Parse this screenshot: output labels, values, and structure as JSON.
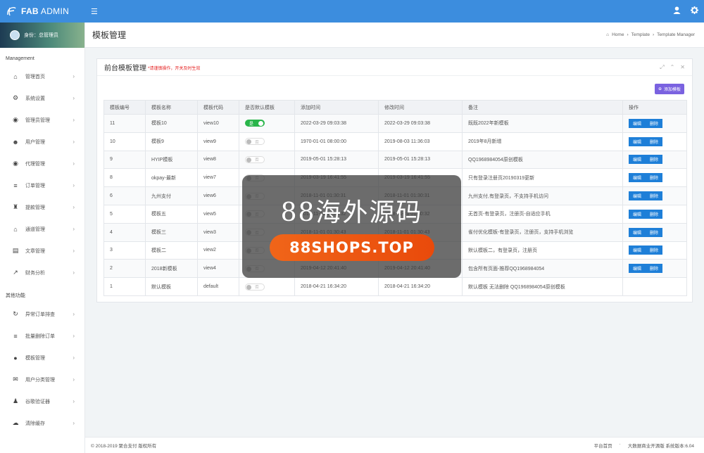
{
  "brand": {
    "name_bold": "FAB",
    "name_rest": "ADMIN"
  },
  "colors": {
    "primary": "#3c8dde",
    "add_button": "#7a62e0",
    "edit_button": "#1e7fd8",
    "toggle_on": "#29b54a",
    "hint_red": "#e52222"
  },
  "profile": {
    "label": "身份：总管理员"
  },
  "sidebar": {
    "section1": "Management",
    "items1": [
      {
        "label": "管理首页",
        "icon": "home-icon"
      },
      {
        "label": "系统设置",
        "icon": "cogs-icon"
      },
      {
        "label": "管理员管理",
        "icon": "user-circle-icon"
      },
      {
        "label": "用户管理",
        "icon": "users-icon"
      },
      {
        "label": "代理管理",
        "icon": "user-circle-icon"
      },
      {
        "label": "订单管理",
        "icon": "list-icon"
      },
      {
        "label": "提款管理",
        "icon": "money-bag-icon"
      },
      {
        "label": "通道管理",
        "icon": "bank-icon"
      },
      {
        "label": "文章管理",
        "icon": "book-icon"
      },
      {
        "label": "财务分析",
        "icon": "line-chart-icon"
      }
    ],
    "section2": "其他功能",
    "items2": [
      {
        "label": "异常订单排查",
        "icon": "refresh-icon"
      },
      {
        "label": "批量删除订单",
        "icon": "list-icon"
      },
      {
        "label": "模板管理",
        "icon": "apple-icon"
      },
      {
        "label": "用户分类管理",
        "icon": "wechat-icon"
      },
      {
        "label": "谷歌验证器",
        "icon": "user-icon"
      },
      {
        "label": "清除缓存",
        "icon": "cloud-icon"
      }
    ]
  },
  "page": {
    "title": "模板管理",
    "breadcrumb": [
      "Home",
      "Template",
      "Template Manager"
    ]
  },
  "panel": {
    "title": "前台模板管理",
    "hint": "*请谨慎操作，开关及时生效",
    "add_button": "添加模板"
  },
  "table": {
    "headers": [
      "模板编号",
      "模板名称",
      "模板代码",
      "是否默认模板",
      "添加时间",
      "修改时间",
      "备注",
      "操作"
    ],
    "toggle_on": "是",
    "toggle_off": "否",
    "edit_label": "编辑",
    "delete_label": "删除",
    "rows": [
      {
        "id": "11",
        "name": "模板10",
        "code": "view10",
        "default": true,
        "added": "2022-03-29 09:03:38",
        "modified": "2022-03-29 09:03:38",
        "note": "既既2022年新模板",
        "ops": true
      },
      {
        "id": "10",
        "name": "模板9",
        "code": "view9",
        "default": false,
        "added": "1970-01-01 08:00:00",
        "modified": "2019-08-03 11:36:03",
        "note": "2019年8月新增",
        "ops": true
      },
      {
        "id": "9",
        "name": "HYIP模板",
        "code": "view8",
        "default": false,
        "added": "2019-05-01 15:28:13",
        "modified": "2019-05-01 15:28:13",
        "note": "QQ1968984054原创模板",
        "ops": true
      },
      {
        "id": "8",
        "name": "okpay-最新",
        "code": "view7",
        "default": false,
        "added": "2019-03-19 16:41:55",
        "modified": "2019-03-19 16:41:55",
        "note": "只有登录注册页20190319更新",
        "ops": true
      },
      {
        "id": "6",
        "name": "九州支付",
        "code": "view6",
        "default": false,
        "added": "2018-11-01 01:30:31",
        "modified": "2018-11-01 01:30:31",
        "note": "九州支付,有登录页，不支持手机访问",
        "ops": true
      },
      {
        "id": "5",
        "name": "模板五",
        "code": "view5",
        "default": false,
        "added": "2018-11-01 01:30:32",
        "modified": "2018-11-01 01:30:32",
        "note": "无首页-有登录页，注册页-自适应手机",
        "ops": true
      },
      {
        "id": "4",
        "name": "模板三",
        "code": "view3",
        "default": false,
        "added": "2018-11-01 01:30:43",
        "modified": "2018-11-01 01:30:43",
        "note": "雀付优化模板-有登录页，注册页，支持手机浏览",
        "ops": true
      },
      {
        "id": "3",
        "name": "模板二",
        "code": "view2",
        "default": false,
        "added": "2018-11-01 01:30:43",
        "modified": "2018-11-01 01:30:43",
        "note": "默认模板二，有登录页，注册页",
        "ops": true
      },
      {
        "id": "2",
        "name": "2018新模板",
        "code": "view4",
        "default": false,
        "added": "2019-04-12 20:41:40",
        "modified": "2019-04-12 20:41:40",
        "note": "包含所有页面-推荐QQ1968984054",
        "ops": true
      },
      {
        "id": "1",
        "name": "默认模板",
        "code": "default",
        "default": false,
        "added": "2018-04-21 16:34:20",
        "modified": "2018-04-21 16:34:20",
        "note": "默认模板 无法删除 QQ1968984054原创模板",
        "ops": false
      }
    ]
  },
  "watermark": {
    "text": "88海外源码",
    "pill": "88SHOPS.TOP"
  },
  "footer": {
    "copyright": "© 2018-2019 聚合支付 版权所有",
    "link": "平台首页",
    "version": "大数据商业开源版 系统版本:6.04"
  }
}
